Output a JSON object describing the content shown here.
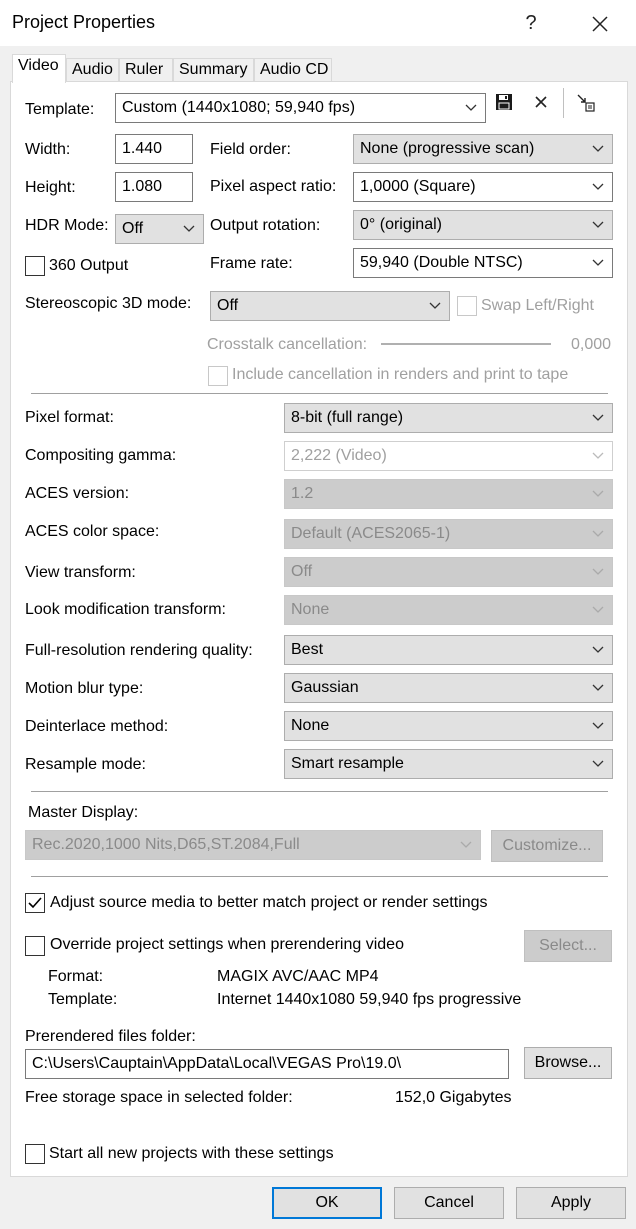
{
  "window": {
    "title": "Project Properties",
    "help_glyph": "?",
    "close_glyph": "✕"
  },
  "tabs": [
    {
      "label": "Video",
      "active": true
    },
    {
      "label": "Audio"
    },
    {
      "label": "Ruler"
    },
    {
      "label": "Summary"
    },
    {
      "label": "Audio CD"
    }
  ],
  "template": {
    "label": "Template:",
    "value": "Custom (1440x1080; 59,940 fps)",
    "save_icon": "save-icon",
    "delete_icon": "delete-icon",
    "match_icon": "match-media-icon"
  },
  "width": {
    "label": "Width:",
    "value": "1.440"
  },
  "height": {
    "label": "Height:",
    "value": "1.080"
  },
  "hdr": {
    "label": "HDR Mode:",
    "value": "Off"
  },
  "output360": {
    "label": "360 Output",
    "checked": false
  },
  "field_order": {
    "label": "Field order:",
    "value": "None (progressive scan)"
  },
  "pixel_aspect": {
    "label": "Pixel aspect ratio:",
    "value": "1,0000 (Square)"
  },
  "output_rotation": {
    "label": "Output rotation:",
    "value": "0° (original)"
  },
  "frame_rate": {
    "label": "Frame rate:",
    "value": "59,940 (Double NTSC)"
  },
  "stereo": {
    "label": "Stereoscopic 3D mode:",
    "value": "Off",
    "swap_label": "Swap Left/Right"
  },
  "crosstalk": {
    "label": "Crosstalk cancellation:",
    "value": "0,000",
    "include_label": "Include cancellation in renders and print to tape"
  },
  "pixel_format": {
    "label": "Pixel format:",
    "value": "8-bit (full range)"
  },
  "compositing_gamma": {
    "label": "Compositing gamma:",
    "value": "2,222 (Video)"
  },
  "aces_version": {
    "label": "ACES version:",
    "value": "1.2"
  },
  "aces_color_space": {
    "label": "ACES color space:",
    "value": "Default (ACES2065-1)"
  },
  "view_transform": {
    "label": "View transform:",
    "value": "Off"
  },
  "look_mod": {
    "label": "Look modification transform:",
    "value": "None"
  },
  "render_quality": {
    "label": "Full-resolution rendering quality:",
    "value": "Best"
  },
  "motion_blur": {
    "label": "Motion blur type:",
    "value": "Gaussian"
  },
  "deinterlace": {
    "label": "Deinterlace method:",
    "value": "None"
  },
  "resample": {
    "label": "Resample mode:",
    "value": "Smart resample"
  },
  "master_display": {
    "label": "Master Display:",
    "value": "Rec.2020,1000 Nits,D65,ST.2084,Full",
    "customize_label": "Customize..."
  },
  "adjust_source": {
    "label": "Adjust source media to better match project or render settings",
    "checked": true
  },
  "override": {
    "label": "Override project settings when prerendering video",
    "checked": false,
    "select_label": "Select...",
    "format_label": "Format:",
    "format_value": "MAGIX AVC/AAC MP4",
    "template_label": "Template:",
    "template_value": "Internet 1440x1080 59,940 fps progressive"
  },
  "prerender": {
    "label": "Prerendered files folder:",
    "path": "C:\\Users\\Cauptain\\AppData\\Local\\VEGAS Pro\\19.0\\",
    "browse_label": "Browse...",
    "free_label": "Free storage space in selected folder:",
    "free_value": "152,0 Gigabytes"
  },
  "start_all": {
    "label": "Start all new projects with these settings",
    "checked": false
  },
  "buttons": {
    "ok": "OK",
    "cancel": "Cancel",
    "apply": "Apply"
  },
  "colors": {
    "accent": "#0078d7",
    "disabled_text": "#a0a0a0",
    "checkbox_check": "#000000"
  }
}
